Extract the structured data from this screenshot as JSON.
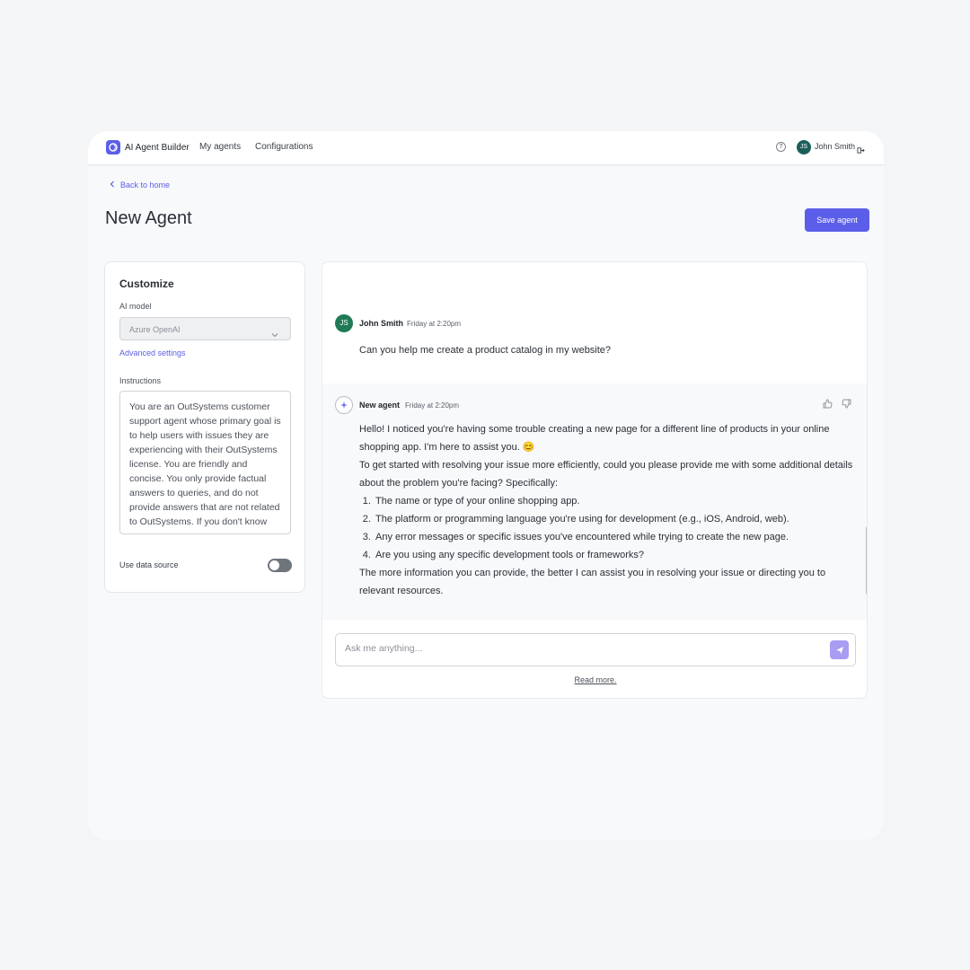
{
  "brand": {
    "name": "AI Agent Builder"
  },
  "nav": {
    "my_agents": "My agents",
    "configurations": "Configurations"
  },
  "user": {
    "initials": "JS",
    "name": "John Smith"
  },
  "back_link": "Back to home",
  "page_title": "New Agent",
  "save_button": "Save agent",
  "customize": {
    "title": "Customize",
    "ai_model_label": "AI model",
    "ai_model_value": "Azure OpenAI",
    "advanced_settings": "Advanced settings",
    "instructions_label": "Instructions",
    "instructions_value": "You are an OutSystems customer support agent whose primary goal is to help users with issues they are experiencing with their OutSystems license. You are friendly and concise. You only provide factual answers to queries, and do not provide answers that are not related to OutSystems. If you don't know",
    "data_source_label": "Use data source",
    "data_source_enabled": false
  },
  "chat": {
    "messages": [
      {
        "sender": "John Smith",
        "initials": "JS",
        "time": "Friday at 2:20pm",
        "text": "Can you help me create a product catalog in my website?"
      },
      {
        "sender": "New agent",
        "time": "Friday at 2:20pm",
        "intro": "Hello! I noticed you're having some trouble creating a new page for a different line of products in your online shopping app. I'm here to assist you. 😊",
        "lead": "To get started with resolving your issue more efficiently, could you please provide me with some additional details about the problem you're facing? Specifically:",
        "list": [
          "The name or type of your online shopping app.",
          "The platform or programming language you're using for development (e.g., iOS, Android, web).",
          "Any error messages or specific issues you've encountered while trying to create the new page.",
          "Are you using any specific development tools or frameworks?"
        ],
        "outro": "The more information you can provide, the better I can assist you in resolving your issue or directing you to relevant resources."
      }
    ],
    "input_placeholder": "Ask me anything...",
    "read_more": "Read more."
  },
  "colors": {
    "accent": "#5b5ee8",
    "user_avatar": "#1f7a55",
    "send_button": "#a99cf3"
  }
}
